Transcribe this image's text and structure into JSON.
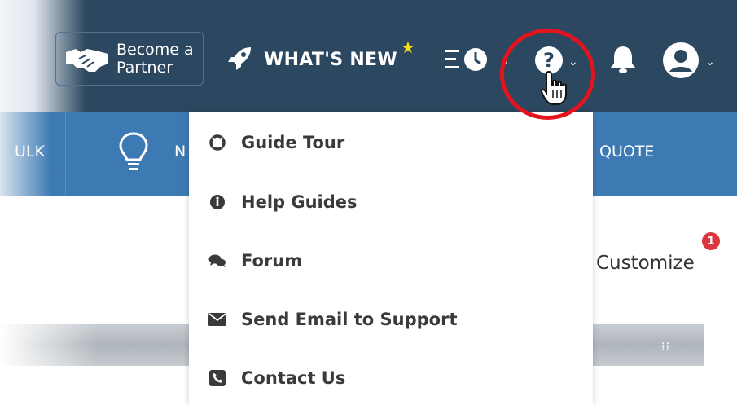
{
  "topbar": {
    "partner_line1": "Become a",
    "partner_line2": "Partner",
    "whats_new": "WHAT'S NEW",
    "icons": [
      "handshake-icon",
      "rocket-icon",
      "star-icon",
      "recent-history-icon",
      "chevron-down-icon",
      "help-icon",
      "bell-icon",
      "user-avatar-icon",
      "hand-cursor-icon"
    ]
  },
  "subbar": {
    "tab_bulk": "ULK",
    "tab_n": "N",
    "tab_quote": "QUOTE",
    "icons": [
      "lightbulb-icon"
    ]
  },
  "content": {
    "customize": "Customize",
    "notification_count": "1"
  },
  "help_menu": {
    "items": [
      {
        "label": "Guide Tour",
        "icon": "life-ring-icon"
      },
      {
        "label": "Help Guides",
        "icon": "info-circle-icon"
      },
      {
        "label": "Forum",
        "icon": "comments-icon"
      },
      {
        "label": "Send Email to Support",
        "icon": "envelope-icon"
      },
      {
        "label": "Contact Us",
        "icon": "phone-icon"
      }
    ]
  },
  "colors": {
    "topbar": "#2c4760",
    "subbar": "#3d7ab4",
    "highlight": "#e3141e",
    "star": "#f5dd1c",
    "badge": "#d9363e"
  }
}
